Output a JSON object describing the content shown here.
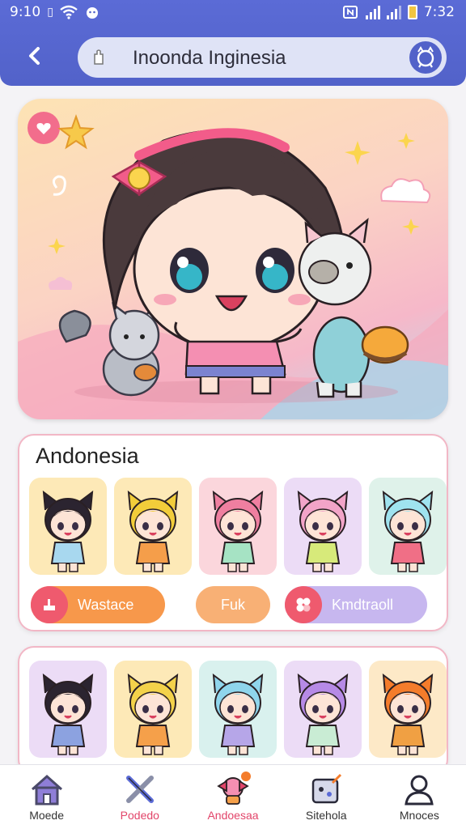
{
  "status_bar": {
    "time_left": "9:10",
    "time_right": "7:32"
  },
  "header": {
    "title": "Inoonda Inginesia"
  },
  "hero": {
    "image": "chibi-girl-with-pets-illustration"
  },
  "section1": {
    "title": "Andonesia",
    "tiles": [
      {
        "bg": "#fde9b7",
        "hair": "#2b2430",
        "shirt": "#a8d8ef"
      },
      {
        "bg": "#fde9b7",
        "hair": "#f2cd3a",
        "shirt": "#f59e4a"
      },
      {
        "bg": "#fbd6dc",
        "hair": "#ef7fa0",
        "shirt": "#a6e3c4"
      },
      {
        "bg": "#ecdcf6",
        "hair": "#f2a4c8",
        "shirt": "#d7ea7a"
      },
      {
        "bg": "#dff2ea",
        "hair": "#9fe3ef",
        "shirt": "#f06f86"
      }
    ],
    "pills": [
      {
        "label": "Wastace",
        "color": "#f7984b",
        "icon_color": "#ef5a6e"
      },
      {
        "label": "Fuk",
        "color": "#f8b075"
      },
      {
        "label": "Kmdtraoll",
        "color": "#c7b7ef",
        "icon_color": "#ef5a6e"
      }
    ]
  },
  "section2": {
    "tiles": [
      {
        "bg": "#ecdcf6",
        "hair": "#2b2430",
        "shirt": "#8ca2e0"
      },
      {
        "bg": "#fde9b7",
        "hair": "#f3d24a",
        "shirt": "#f5a04a"
      },
      {
        "bg": "#d9f1ee",
        "hair": "#8fd5ec",
        "shirt": "#b6a6e8"
      },
      {
        "bg": "#ecdcf6",
        "hair": "#b68ae6",
        "shirt": "#c9ecd4"
      },
      {
        "bg": "#fde9c7",
        "hair": "#f47c2b",
        "shirt": "#f0a043"
      }
    ]
  },
  "nav": {
    "items": [
      {
        "label": "Moede",
        "icon": "home-icon",
        "color": "#333"
      },
      {
        "label": "Podedo",
        "icon": "crossed-tools-icon",
        "color": "#e2456a"
      },
      {
        "label": "Andoesaa",
        "icon": "character-icon",
        "color": "#e2456a"
      },
      {
        "label": "Sitehola",
        "icon": "game-icon",
        "color": "#333"
      },
      {
        "label": "Mnoces",
        "icon": "user-icon",
        "color": "#333"
      }
    ]
  }
}
